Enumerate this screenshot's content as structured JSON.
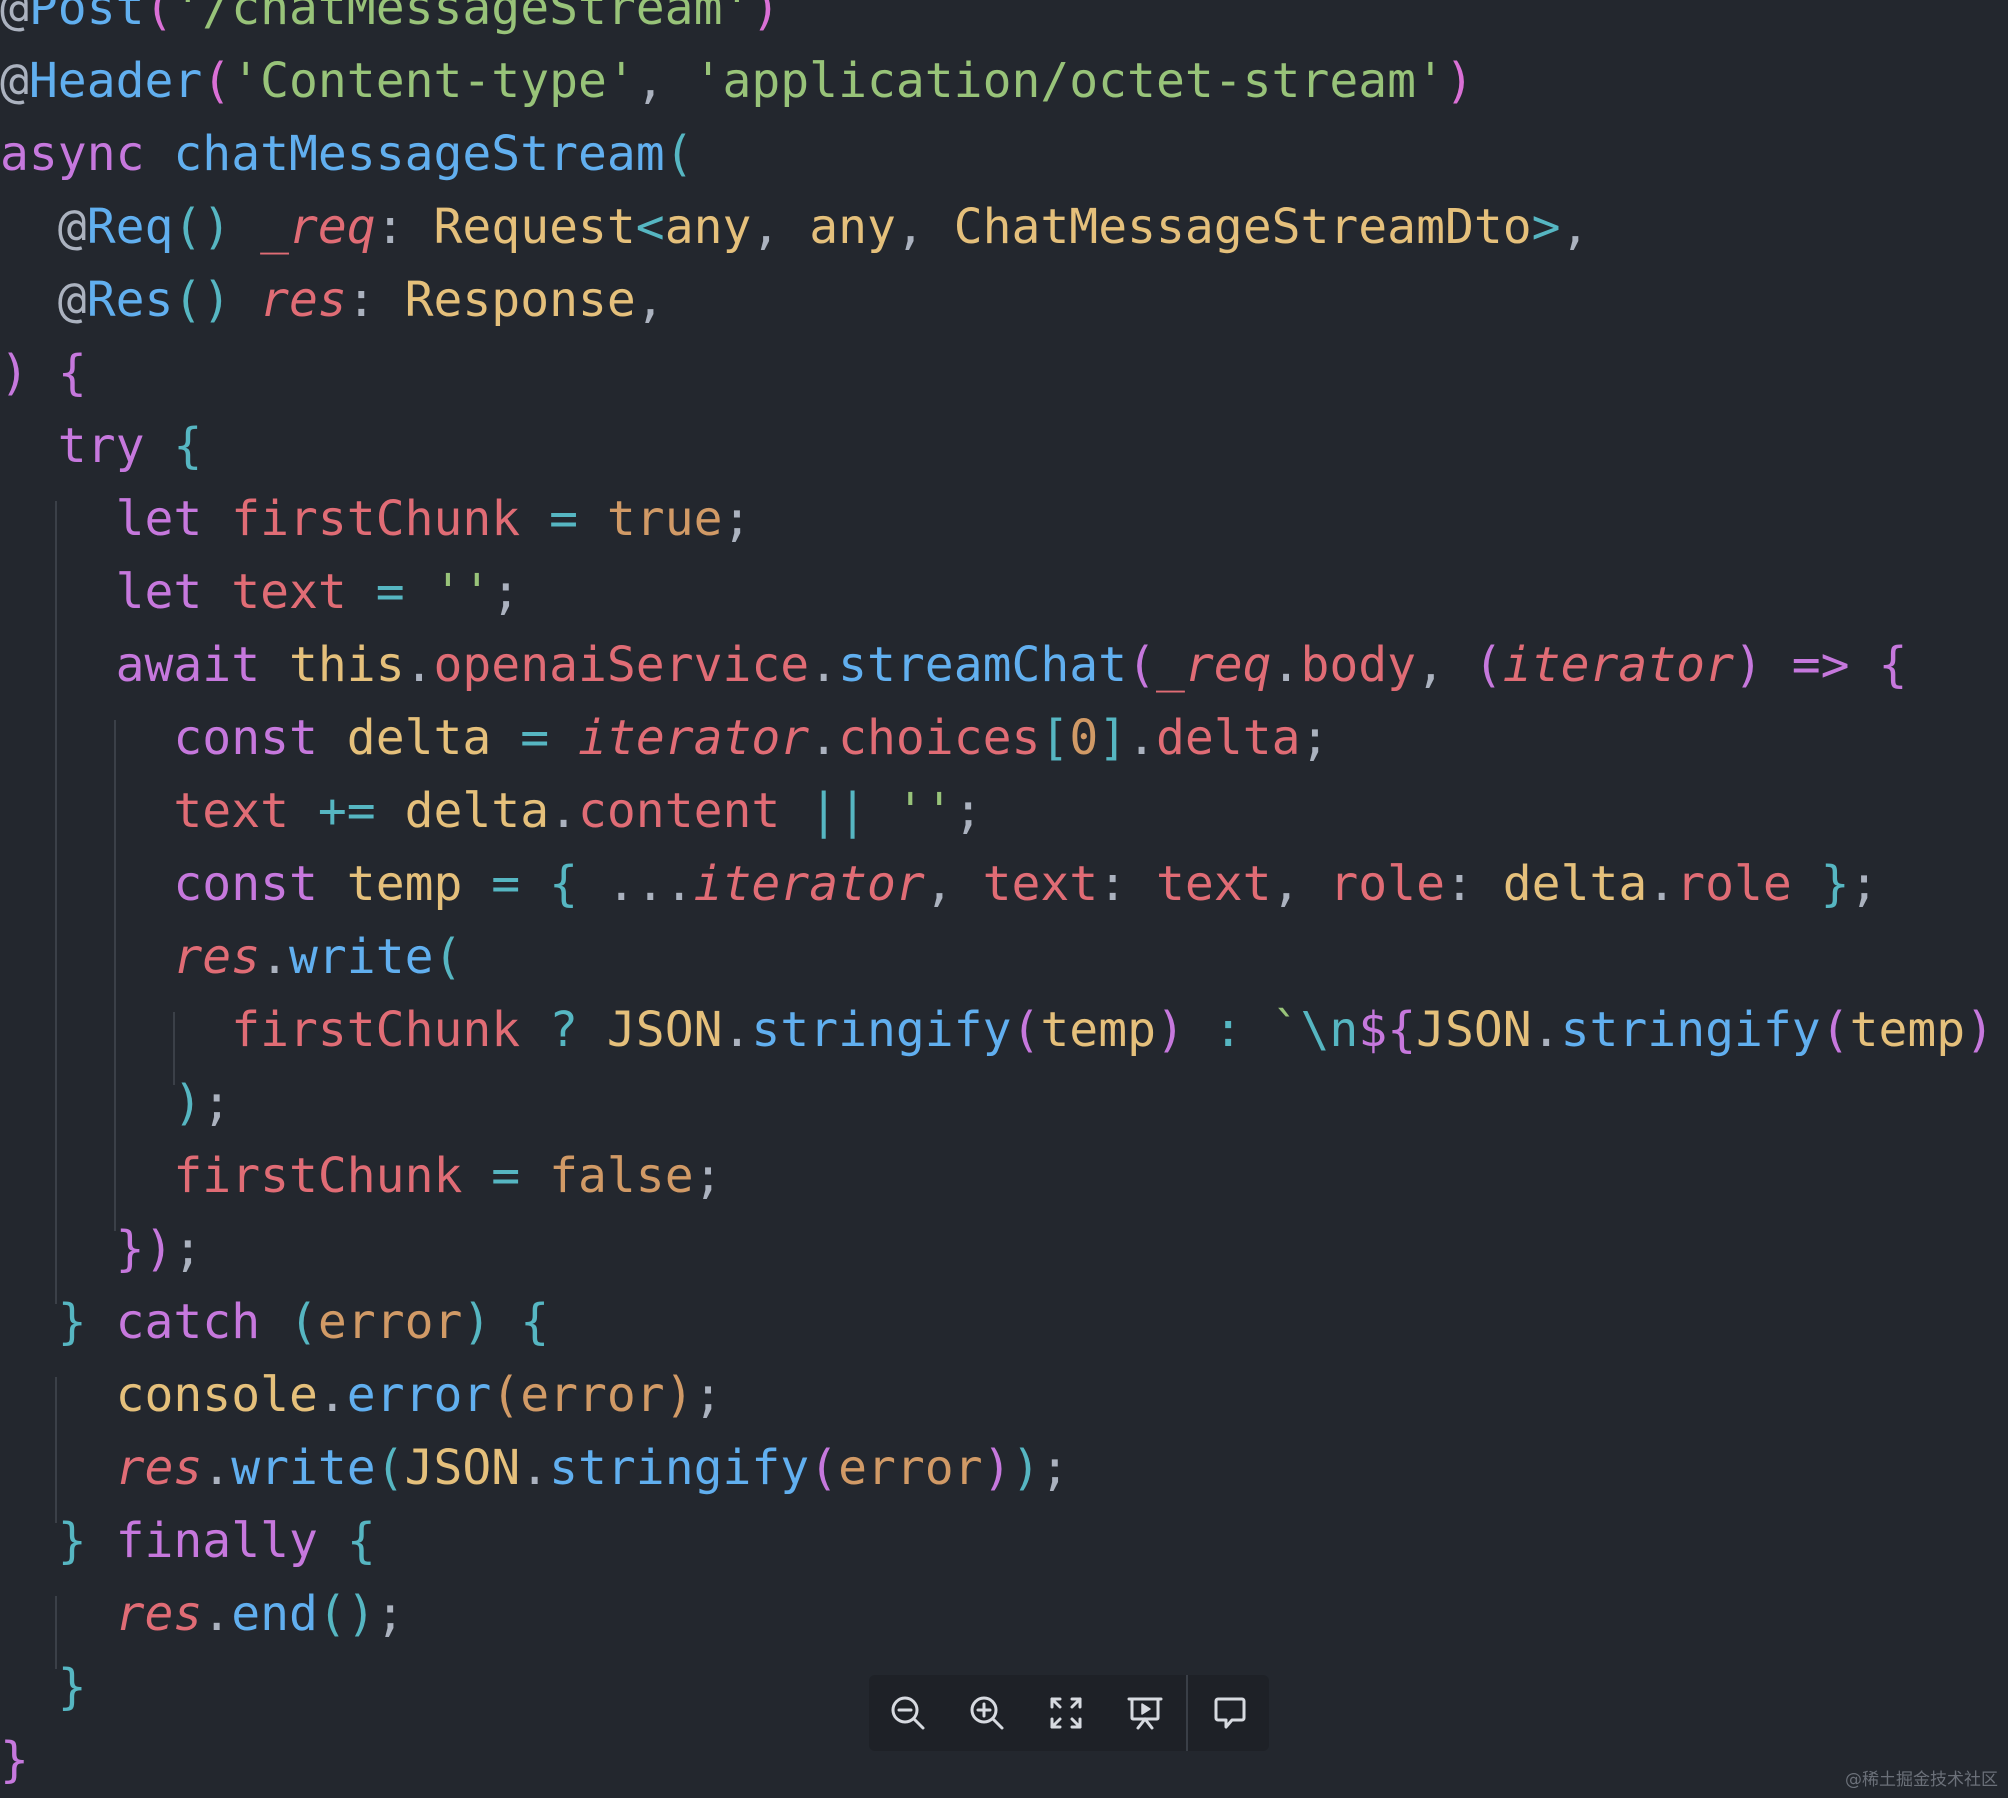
{
  "colors": {
    "background": "#23272e",
    "keyword": "#c678dd",
    "function": "#61afef",
    "string": "#98c379",
    "variable": "#e06c75",
    "type": "#e5c07b",
    "number": "#d19a66",
    "operator": "#56b6c2",
    "punctuation": "#abb2bf",
    "decorator": "#abb2bf",
    "bracket_gold": "#ffd700",
    "bracket_pink": "#da70d6",
    "bracket_blue": "#179fff",
    "toolbar_icon": "#d7dae0"
  },
  "code": {
    "lines": [
      [
        [
          "@",
          "decorator"
        ],
        [
          "Post",
          "function"
        ],
        [
          "(",
          "bracket_pink"
        ],
        [
          "'/chatMessageStream'",
          "string"
        ],
        [
          ")",
          "bracket_pink"
        ]
      ],
      [
        [
          "@",
          "decorator"
        ],
        [
          "Header",
          "function"
        ],
        [
          "(",
          "bracket_pink"
        ],
        [
          "'Content-type'",
          "string"
        ],
        [
          ", ",
          "punctuation"
        ],
        [
          "'application/octet-stream'",
          "string"
        ],
        [
          ")",
          "bracket_pink"
        ]
      ],
      [
        [
          "async",
          "keyword"
        ],
        [
          " ",
          "punctuation"
        ],
        [
          "chatMessageStream",
          "function"
        ],
        [
          "(",
          "operator"
        ]
      ],
      [
        [
          "  ",
          "punctuation"
        ],
        [
          "@",
          "decorator"
        ],
        [
          "Req",
          "function"
        ],
        [
          "()",
          "operator"
        ],
        [
          " ",
          "punctuation"
        ],
        [
          "_req",
          "variable",
          "it"
        ],
        [
          ": ",
          "punctuation"
        ],
        [
          "Request",
          "type"
        ],
        [
          "<",
          "operator"
        ],
        [
          "any",
          "type"
        ],
        [
          ", ",
          "punctuation"
        ],
        [
          "any",
          "type"
        ],
        [
          ", ",
          "punctuation"
        ],
        [
          "ChatMessageStreamDto",
          "type"
        ],
        [
          ">",
          "operator"
        ],
        [
          ",",
          "punctuation"
        ]
      ],
      [
        [
          "  ",
          "punctuation"
        ],
        [
          "@",
          "decorator"
        ],
        [
          "Res",
          "function"
        ],
        [
          "()",
          "operator"
        ],
        [
          " ",
          "punctuation"
        ],
        [
          "res",
          "variable",
          "it"
        ],
        [
          ": ",
          "punctuation"
        ],
        [
          "Response",
          "type"
        ],
        [
          ",",
          "punctuation"
        ]
      ],
      [
        [
          ")",
          "keyword"
        ],
        [
          " ",
          "punctuation"
        ],
        [
          "{",
          "keyword"
        ]
      ],
      [
        [
          "  ",
          "punctuation"
        ],
        [
          "try",
          "keyword"
        ],
        [
          " ",
          "punctuation"
        ],
        [
          "{",
          "operator"
        ]
      ],
      [
        [
          "    ",
          "punctuation"
        ],
        [
          "let",
          "keyword"
        ],
        [
          " ",
          "punctuation"
        ],
        [
          "firstChunk",
          "variable"
        ],
        [
          " ",
          "punctuation"
        ],
        [
          "=",
          "operator"
        ],
        [
          " ",
          "punctuation"
        ],
        [
          "true",
          "number"
        ],
        [
          ";",
          "punctuation"
        ]
      ],
      [
        [
          "    ",
          "punctuation"
        ],
        [
          "let",
          "keyword"
        ],
        [
          " ",
          "punctuation"
        ],
        [
          "text",
          "variable"
        ],
        [
          " ",
          "punctuation"
        ],
        [
          "=",
          "operator"
        ],
        [
          " ",
          "punctuation"
        ],
        [
          "''",
          "string"
        ],
        [
          ";",
          "punctuation"
        ]
      ],
      [
        [
          "    ",
          "punctuation"
        ],
        [
          "await",
          "keyword"
        ],
        [
          " ",
          "punctuation"
        ],
        [
          "this",
          "type"
        ],
        [
          ".",
          "punctuation"
        ],
        [
          "openaiService",
          "variable"
        ],
        [
          ".",
          "punctuation"
        ],
        [
          "streamChat",
          "function"
        ],
        [
          "(",
          "keyword"
        ],
        [
          "_req",
          "variable",
          "it"
        ],
        [
          ".",
          "punctuation"
        ],
        [
          "body",
          "variable"
        ],
        [
          ", ",
          "punctuation"
        ],
        [
          "(",
          "keyword"
        ],
        [
          "iterator",
          "variable",
          "it"
        ],
        [
          ")",
          "keyword"
        ],
        [
          " ",
          "punctuation"
        ],
        [
          "=>",
          "keyword"
        ],
        [
          " ",
          "punctuation"
        ],
        [
          "{",
          "keyword"
        ]
      ],
      [
        [
          "      ",
          "punctuation"
        ],
        [
          "const",
          "keyword"
        ],
        [
          " ",
          "punctuation"
        ],
        [
          "delta",
          "type"
        ],
        [
          " ",
          "punctuation"
        ],
        [
          "=",
          "operator"
        ],
        [
          " ",
          "punctuation"
        ],
        [
          "iterator",
          "variable",
          "it"
        ],
        [
          ".",
          "punctuation"
        ],
        [
          "choices",
          "variable"
        ],
        [
          "[",
          "operator"
        ],
        [
          "0",
          "number"
        ],
        [
          "]",
          "operator"
        ],
        [
          ".",
          "punctuation"
        ],
        [
          "delta",
          "variable"
        ],
        [
          ";",
          "punctuation"
        ]
      ],
      [
        [
          "      ",
          "punctuation"
        ],
        [
          "text",
          "variable"
        ],
        [
          " ",
          "punctuation"
        ],
        [
          "+=",
          "operator"
        ],
        [
          " ",
          "punctuation"
        ],
        [
          "delta",
          "type"
        ],
        [
          ".",
          "punctuation"
        ],
        [
          "content",
          "variable"
        ],
        [
          " ",
          "punctuation"
        ],
        [
          "||",
          "operator"
        ],
        [
          " ",
          "punctuation"
        ],
        [
          "''",
          "string"
        ],
        [
          ";",
          "punctuation"
        ]
      ],
      [
        [
          "      ",
          "punctuation"
        ],
        [
          "const",
          "keyword"
        ],
        [
          " ",
          "punctuation"
        ],
        [
          "temp",
          "type"
        ],
        [
          " ",
          "punctuation"
        ],
        [
          "=",
          "operator"
        ],
        [
          " ",
          "punctuation"
        ],
        [
          "{",
          "operator"
        ],
        [
          " ...",
          "punctuation"
        ],
        [
          "iterator",
          "variable",
          "it"
        ],
        [
          ", ",
          "punctuation"
        ],
        [
          "text",
          "variable"
        ],
        [
          ": ",
          "punctuation"
        ],
        [
          "text",
          "variable"
        ],
        [
          ", ",
          "punctuation"
        ],
        [
          "role",
          "variable"
        ],
        [
          ": ",
          "punctuation"
        ],
        [
          "delta",
          "type"
        ],
        [
          ".",
          "punctuation"
        ],
        [
          "role",
          "variable"
        ],
        [
          " ",
          "punctuation"
        ],
        [
          "}",
          "operator"
        ],
        [
          ";",
          "punctuation"
        ]
      ],
      [
        [
          "      ",
          "punctuation"
        ],
        [
          "res",
          "variable",
          "it"
        ],
        [
          ".",
          "punctuation"
        ],
        [
          "write",
          "function"
        ],
        [
          "(",
          "operator"
        ]
      ],
      [
        [
          "        ",
          "punctuation"
        ],
        [
          "firstChunk",
          "variable"
        ],
        [
          " ",
          "punctuation"
        ],
        [
          "?",
          "operator"
        ],
        [
          " ",
          "punctuation"
        ],
        [
          "JSON",
          "type"
        ],
        [
          ".",
          "punctuation"
        ],
        [
          "stringify",
          "function"
        ],
        [
          "(",
          "keyword"
        ],
        [
          "temp",
          "type"
        ],
        [
          ")",
          "keyword"
        ],
        [
          " ",
          "punctuation"
        ],
        [
          ":",
          "operator"
        ],
        [
          " ",
          "punctuation"
        ],
        [
          "`",
          "string"
        ],
        [
          "\\n",
          "operator"
        ],
        [
          "${",
          "keyword"
        ],
        [
          "JSON",
          "type"
        ],
        [
          ".",
          "punctuation"
        ],
        [
          "stringify",
          "function"
        ],
        [
          "(",
          "keyword"
        ],
        [
          "temp",
          "type"
        ],
        [
          ")",
          "keyword"
        ]
      ],
      [
        [
          "      ",
          "punctuation"
        ],
        [
          ")",
          "operator"
        ],
        [
          ";",
          "punctuation"
        ]
      ],
      [
        [
          "      ",
          "punctuation"
        ],
        [
          "firstChunk",
          "variable"
        ],
        [
          " ",
          "punctuation"
        ],
        [
          "=",
          "operator"
        ],
        [
          " ",
          "punctuation"
        ],
        [
          "false",
          "number"
        ],
        [
          ";",
          "punctuation"
        ]
      ],
      [
        [
          "    ",
          "punctuation"
        ],
        [
          "})",
          "keyword"
        ],
        [
          ";",
          "punctuation"
        ]
      ],
      [
        [
          "  ",
          "punctuation"
        ],
        [
          "}",
          "operator"
        ],
        [
          " ",
          "punctuation"
        ],
        [
          "catch",
          "keyword"
        ],
        [
          " ",
          "punctuation"
        ],
        [
          "(",
          "operator"
        ],
        [
          "error",
          "number"
        ],
        [
          ")",
          "operator"
        ],
        [
          " ",
          "punctuation"
        ],
        [
          "{",
          "operator"
        ]
      ],
      [
        [
          "    ",
          "punctuation"
        ],
        [
          "console",
          "type"
        ],
        [
          ".",
          "punctuation"
        ],
        [
          "error",
          "function"
        ],
        [
          "(",
          "number"
        ],
        [
          "error",
          "number"
        ],
        [
          ")",
          "number"
        ],
        [
          ";",
          "punctuation"
        ]
      ],
      [
        [
          "    ",
          "punctuation"
        ],
        [
          "res",
          "variable",
          "it"
        ],
        [
          ".",
          "punctuation"
        ],
        [
          "write",
          "function"
        ],
        [
          "(",
          "operator"
        ],
        [
          "JSON",
          "type"
        ],
        [
          ".",
          "punctuation"
        ],
        [
          "stringify",
          "function"
        ],
        [
          "(",
          "keyword"
        ],
        [
          "error",
          "number"
        ],
        [
          ")",
          "keyword"
        ],
        [
          ")",
          "operator"
        ],
        [
          ";",
          "punctuation"
        ]
      ],
      [
        [
          "  ",
          "punctuation"
        ],
        [
          "}",
          "operator"
        ],
        [
          " ",
          "punctuation"
        ],
        [
          "finally",
          "keyword"
        ],
        [
          " ",
          "punctuation"
        ],
        [
          "{",
          "operator"
        ]
      ],
      [
        [
          "    ",
          "punctuation"
        ],
        [
          "res",
          "variable",
          "it"
        ],
        [
          ".",
          "punctuation"
        ],
        [
          "end",
          "function"
        ],
        [
          "()",
          "operator"
        ],
        [
          ";",
          "punctuation"
        ]
      ],
      [
        [
          "  ",
          "punctuation"
        ],
        [
          "}",
          "operator"
        ]
      ],
      [
        [
          "}",
          "keyword"
        ]
      ]
    ]
  },
  "toolbar": {
    "buttons": [
      {
        "name": "zoom-out-button",
        "icon": "zoom-out-icon"
      },
      {
        "name": "zoom-in-button",
        "icon": "zoom-in-icon"
      },
      {
        "name": "fit-screen-button",
        "icon": "expand-icon"
      },
      {
        "name": "present-button",
        "icon": "presentation-icon"
      },
      {
        "name": "comment-button",
        "icon": "comment-icon"
      }
    ]
  },
  "watermark": "@稀土掘金技术社区"
}
